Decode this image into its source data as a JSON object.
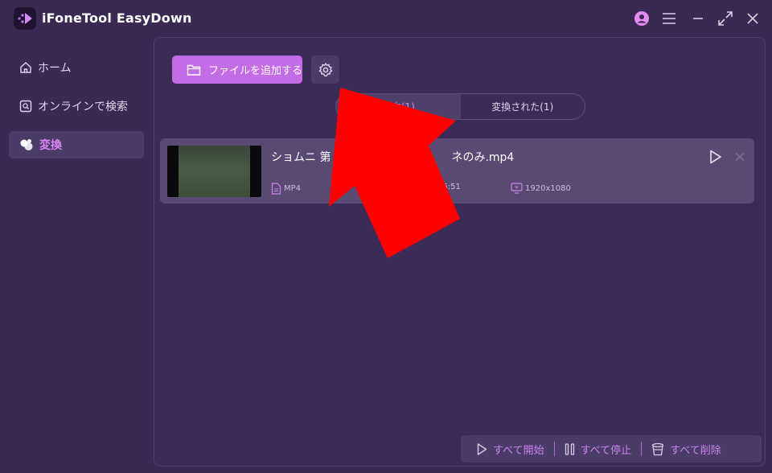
{
  "app": {
    "title": "iFoneTool EasyDown"
  },
  "sidebar": {
    "items": [
      {
        "label": "ホーム",
        "icon": "home-icon"
      },
      {
        "label": "オンラインで検索",
        "icon": "search-icon"
      },
      {
        "label": "変換",
        "icon": "convert-icon",
        "active": true
      }
    ]
  },
  "toolbar": {
    "add_file_label": "ファイルを追加する",
    "settings_icon": "gear-icon"
  },
  "tabs": [
    {
      "label": "換中(1)",
      "active": true
    },
    {
      "label": "変換された(1)",
      "active": false
    }
  ],
  "file": {
    "name": "ショムニ 第",
    "name_tail": "ネのみ.mp4",
    "format": "MP4",
    "duration": "46:51",
    "resolution": "1920x1080"
  },
  "bottom_bar": {
    "start_all": "すべて開始",
    "stop_all": "すべて停止",
    "delete_all": "すべて削除"
  },
  "colors": {
    "accent": "#c46ce6",
    "background": "#3a2a53",
    "annotation_arrow": "#ff0000"
  }
}
